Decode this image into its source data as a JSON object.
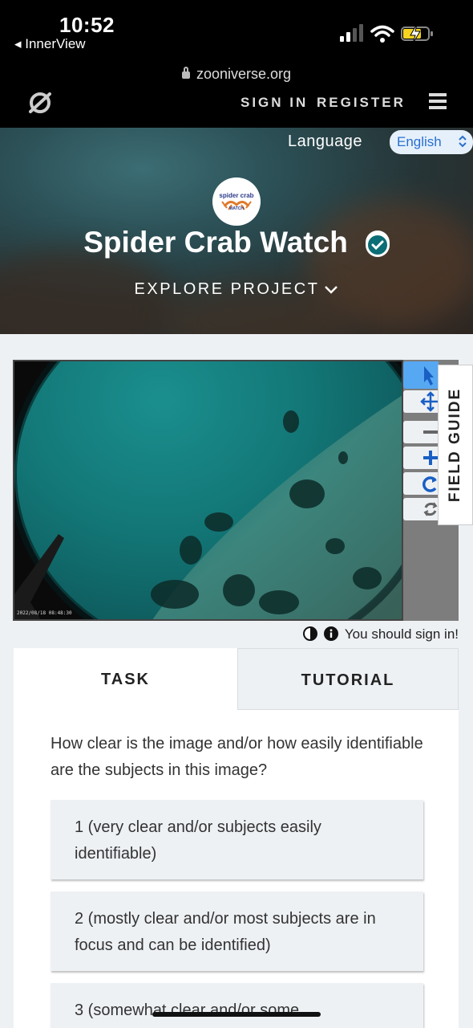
{
  "status_bar": {
    "time": "10:52",
    "back_app": "◂ InnerView"
  },
  "browser": {
    "url": "zooniverse.org"
  },
  "nav": {
    "sign_in": "SIGN IN",
    "register": "REGISTER"
  },
  "hero": {
    "language_label": "Language",
    "language_value": "English",
    "project_title": "Spider Crab Watch",
    "explore_label": "EXPLORE PROJECT",
    "avatar_text_top": "spider crab",
    "avatar_text_bottom": "WATCH"
  },
  "viewer": {
    "timestamp": "2022/08/18 08:48:30",
    "tools": [
      "pointer",
      "pan",
      "zoom-out",
      "zoom-in",
      "rotate",
      "reset"
    ]
  },
  "field_guide": {
    "label": "FIELD GUIDE"
  },
  "sign_in_notice": "You should sign in!",
  "tabs": {
    "task": "TASK",
    "tutorial": "TUTORIAL"
  },
  "task": {
    "question": "How clear is the image and/or how easily identifiable are the subjects in this image?",
    "answers": [
      "1 (very clear and/or subjects easily identifiable)",
      "2 (mostly clear and/or most subjects are in focus and can be identified)",
      "3 (somewhat clear and/or some"
    ]
  },
  "colors": {
    "accent_blue": "#56a8f2",
    "link_blue": "#2a6fcf",
    "verified_teal": "#0b6d75",
    "battery_yellow": "#f5d31f"
  }
}
